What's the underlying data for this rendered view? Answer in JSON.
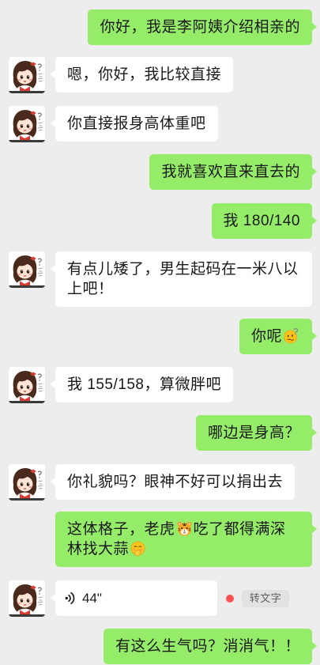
{
  "colors": {
    "chat_background": "#ededed",
    "outgoing_bubble": "#95ec69",
    "incoming_bubble": "#ffffff",
    "message_text": "#191919",
    "unread_dot": "#fa5151",
    "transcribe_button_background": "#e2e2e2",
    "transcribe_button_text": "#5f5f5f"
  },
  "contact": {
    "avatar_icon": "cartoon-girl-avatar-icon"
  },
  "messages": [
    {
      "outgoing": true,
      "text": "你好，我是李阿姨介绍相亲的"
    },
    {
      "outgoing": false,
      "text": "嗯，你好，我比较直接"
    },
    {
      "outgoing": false,
      "text": "你直接报身高体重吧"
    },
    {
      "outgoing": true,
      "text": "我就喜欢直来直去的"
    },
    {
      "outgoing": true,
      "text": "我 180/140"
    },
    {
      "outgoing": false,
      "text": "有点儿矮了，男生起码在一米八以上吧！"
    },
    {
      "outgoing": true,
      "text": "你呢",
      "emoji_icon": "confused-face-emoji-icon"
    },
    {
      "outgoing": false,
      "text": "我 155/158，算微胖吧"
    },
    {
      "outgoing": true,
      "text": "哪边是身高？"
    },
    {
      "outgoing": false,
      "text": "你礼貌吗？眼神不好可以捐出去"
    },
    {
      "outgoing": true,
      "parts": [
        "这体格子，老虎",
        "吃了都得满深林找大蒜"
      ],
      "emoji_icons": [
        "tiger-face-emoji-icon",
        "face-with-hand-over-mouth-emoji-icon"
      ]
    },
    {
      "outgoing": false,
      "voice": {
        "duration": "44\"",
        "unread": true,
        "icon": "voice-wave-icon",
        "transcribe_label": "转文字"
      }
    },
    {
      "outgoing": true,
      "text": "有这么生气吗？消消气！！"
    }
  ]
}
